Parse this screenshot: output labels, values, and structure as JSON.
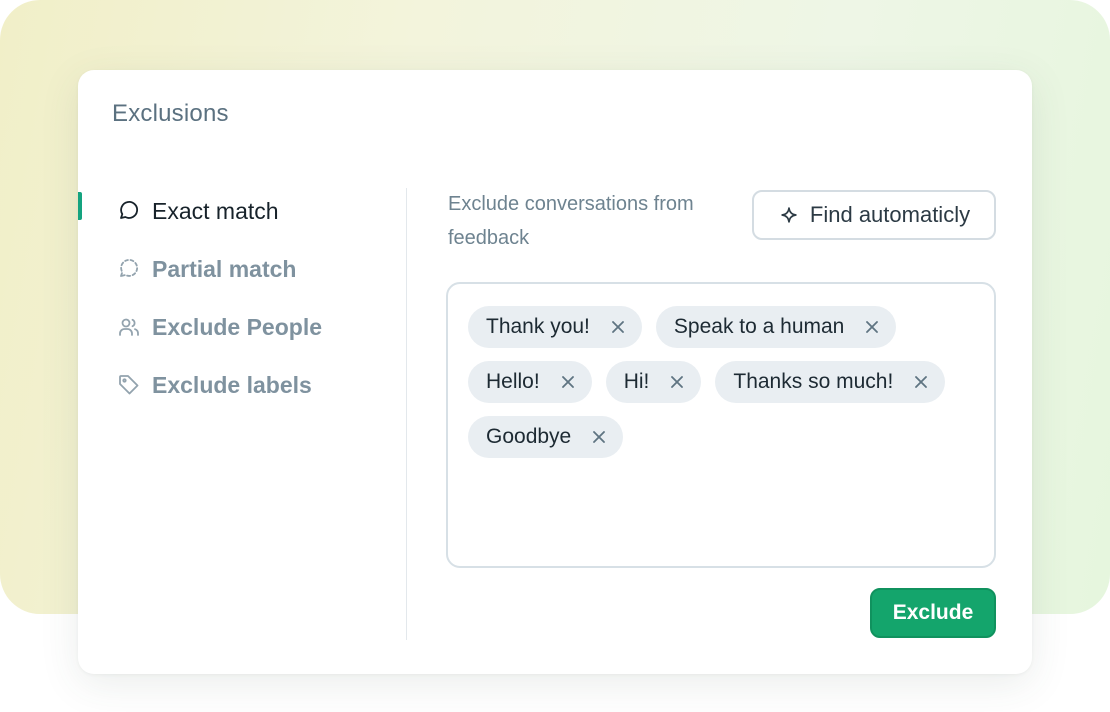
{
  "panel": {
    "title": "Exclusions"
  },
  "nav": {
    "items": [
      {
        "label": "Exact match",
        "icon": "speech-bubble-icon",
        "active": true
      },
      {
        "label": "Partial match",
        "icon": "dashed-speech-bubble-icon",
        "active": false
      },
      {
        "label": "Exclude People",
        "icon": "people-icon",
        "active": false
      },
      {
        "label": "Exclude labels",
        "icon": "tag-icon",
        "active": false
      }
    ]
  },
  "main": {
    "description": "Exclude conversations from feedback",
    "find_button_label": "Find automaticly",
    "find_button_icon": "sparkle-icon",
    "tags": [
      "Thank you!",
      "Speak to a human",
      "Hello!",
      "Hi!",
      "Thanks so much!",
      "Goodbye"
    ],
    "exclude_button_label": "Exclude"
  },
  "colors": {
    "accent": "#14a37f",
    "primary_button": "#14a56c",
    "tag_background": "#e9eef2"
  }
}
